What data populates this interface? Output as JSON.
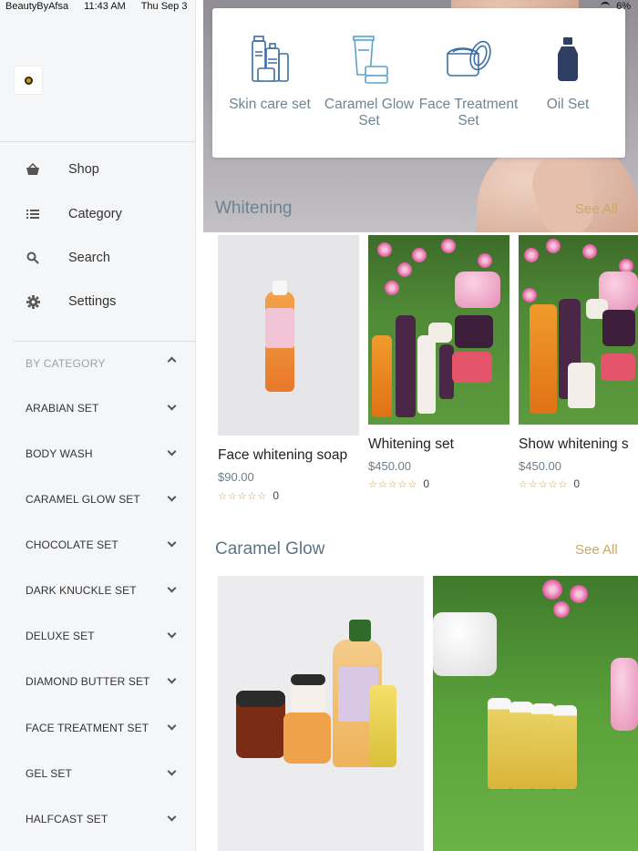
{
  "status_bar": {
    "app": "BeautyByAfsa",
    "time": "11:43 AM",
    "date": "Thu Sep 3",
    "battery": "6%"
  },
  "drawer": {
    "nav": [
      {
        "label": "Shop",
        "icon": "basket-icon"
      },
      {
        "label": "Category",
        "icon": "list-icon"
      },
      {
        "label": "Search",
        "icon": "search-icon"
      },
      {
        "label": "Settings",
        "icon": "gear-icon"
      }
    ],
    "by_category_label": "BY CATEGORY",
    "categories": [
      "ARABIAN SET",
      "BODY WASH",
      "CARAMEL GLOW SET",
      "CHOCOLATE SET",
      "DARK KNUCKLE SET",
      "DELUXE SET",
      "DIAMOND BUTTER SET",
      "FACE TREATMENT SET",
      "GEL SET",
      "HALFCAST SET"
    ]
  },
  "category_card": [
    {
      "label": "Skin care set",
      "icon": "skincare-products-icon"
    },
    {
      "label": "Caramel Glow Set",
      "icon": "cream-tube-icon"
    },
    {
      "label": "Face Treatment Set",
      "icon": "cream-jar-icon"
    },
    {
      "label": "Oil Set",
      "icon": "oil-bottle-icon"
    }
  ],
  "sections": {
    "whitening": {
      "title": "Whitening",
      "see_all": "See All",
      "products": [
        {
          "title": "Face whitening soap",
          "price": "$90.00",
          "stars": "☆☆☆☆☆",
          "count": "0"
        },
        {
          "title": "Whitening set",
          "price": "$450.00",
          "stars": "☆☆☆☆☆",
          "count": "0"
        },
        {
          "title": "Show whitening s",
          "price": "$450.00",
          "stars": "☆☆☆☆☆",
          "count": "0"
        }
      ]
    },
    "caramel_glow": {
      "title": "Caramel Glow",
      "see_all": "See All"
    }
  },
  "colors": {
    "accent_gold": "#c8a96a",
    "slate_text": "#5e7482",
    "icon_blue": "#3b6ea5"
  }
}
